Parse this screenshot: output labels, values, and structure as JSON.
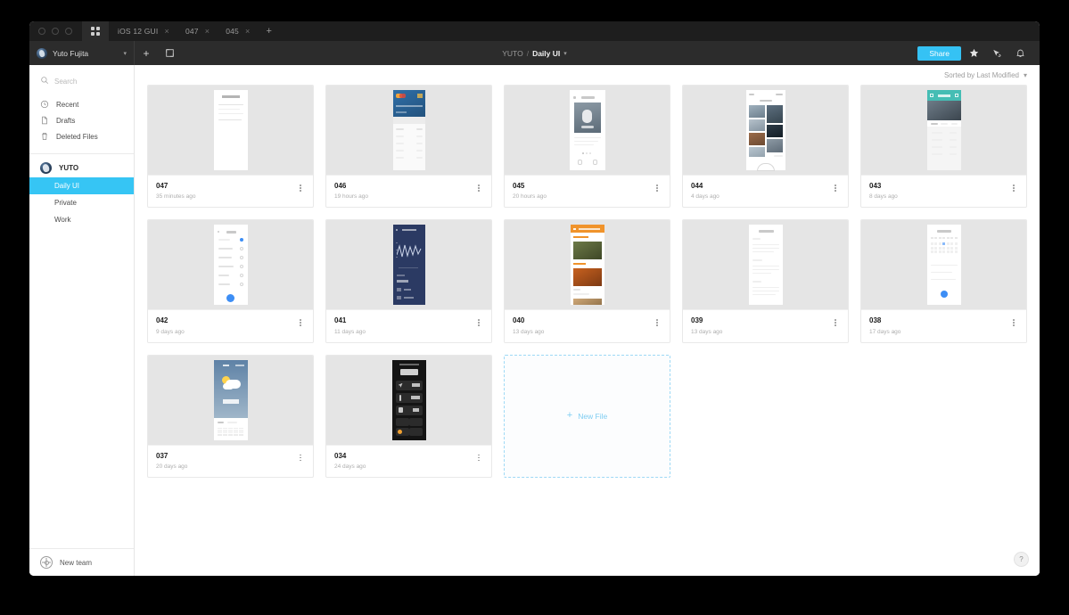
{
  "window": {
    "tabs": [
      {
        "label": "iOS 12 GUI",
        "active": true,
        "closable": true
      },
      {
        "label": "047",
        "active": false,
        "closable": true
      },
      {
        "label": "045",
        "active": false,
        "closable": true
      }
    ],
    "new_tab_label": "+",
    "grid_icon": "grid-icon"
  },
  "toolbar": {
    "user_name": "Yuto Fujita",
    "user_caret": "▾",
    "new_label": "+",
    "edit_icon": "new-frame-icon",
    "breadcrumb": {
      "team": "YUTO",
      "separator": "/",
      "current": "Daily UI",
      "caret": "▾"
    },
    "share_label": "Share",
    "star_icon": "★",
    "presence_icon": "cursors-icon",
    "bell_icon": "🔔",
    "accent_color": "#35c2f4"
  },
  "sidebar": {
    "search_placeholder": "Search",
    "search_value": "",
    "nav": [
      {
        "label": "Recent",
        "icon": "clock-icon"
      },
      {
        "label": "Drafts",
        "icon": "file-icon"
      },
      {
        "label": "Deleted Files",
        "icon": "trash-icon"
      }
    ],
    "team": {
      "name": "YUTO",
      "projects": [
        {
          "label": "Daily UI",
          "active": true
        },
        {
          "label": "Private",
          "active": false
        },
        {
          "label": "Work",
          "active": false
        }
      ]
    },
    "footer": {
      "label": "New team",
      "icon": "new-team-icon"
    }
  },
  "main": {
    "sort_label": "Sorted by Last Modified",
    "sort_caret": "▾",
    "new_file_label": "New File",
    "new_file_plus": "+",
    "help_label": "?",
    "files": [
      {
        "name": "047",
        "modified": "35 minutes ago",
        "thumb": "doc-white"
      },
      {
        "name": "046",
        "modified": "19 hours ago",
        "thumb": "credit-card"
      },
      {
        "name": "045",
        "modified": "20 hours ago",
        "thumb": "photo-article"
      },
      {
        "name": "044",
        "modified": "4 days ago",
        "thumb": "photo-grid"
      },
      {
        "name": "043",
        "modified": "8 days ago",
        "thumb": "teal-header"
      },
      {
        "name": "042",
        "modified": "9 days ago",
        "thumb": "checklist"
      },
      {
        "name": "041",
        "modified": "11 days ago",
        "thumb": "dark-chart"
      },
      {
        "name": "040",
        "modified": "13 days ago",
        "thumb": "food-orange"
      },
      {
        "name": "039",
        "modified": "13 days ago",
        "thumb": "text-doc"
      },
      {
        "name": "038",
        "modified": "17 days ago",
        "thumb": "calendar"
      },
      {
        "name": "037",
        "modified": "20 days ago",
        "thumb": "weather"
      },
      {
        "name": "034",
        "modified": "24 days ago",
        "thumb": "dark-dashboard"
      }
    ]
  }
}
